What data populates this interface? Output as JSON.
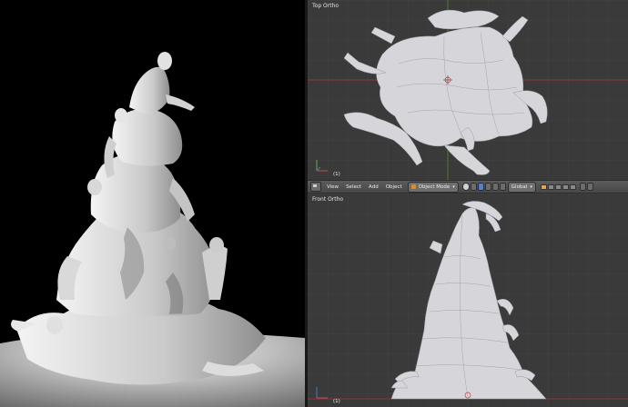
{
  "panes": {
    "top_view": {
      "label": "Top Ortho",
      "frame": "(1)"
    },
    "front_view": {
      "label": "Front Ortho",
      "frame": "(1)"
    }
  },
  "header": {
    "menus": [
      "View",
      "Select",
      "Add",
      "Object"
    ],
    "mode": "Object Mode",
    "orientation": "Global"
  },
  "colors": {
    "viewport_bg": "#3a3a3a",
    "grid": "#424242",
    "x_axis": "#8a3a3a",
    "y_axis": "#4e7a2e",
    "mesh": "#d4d4d8",
    "header_bg": "#505050"
  }
}
